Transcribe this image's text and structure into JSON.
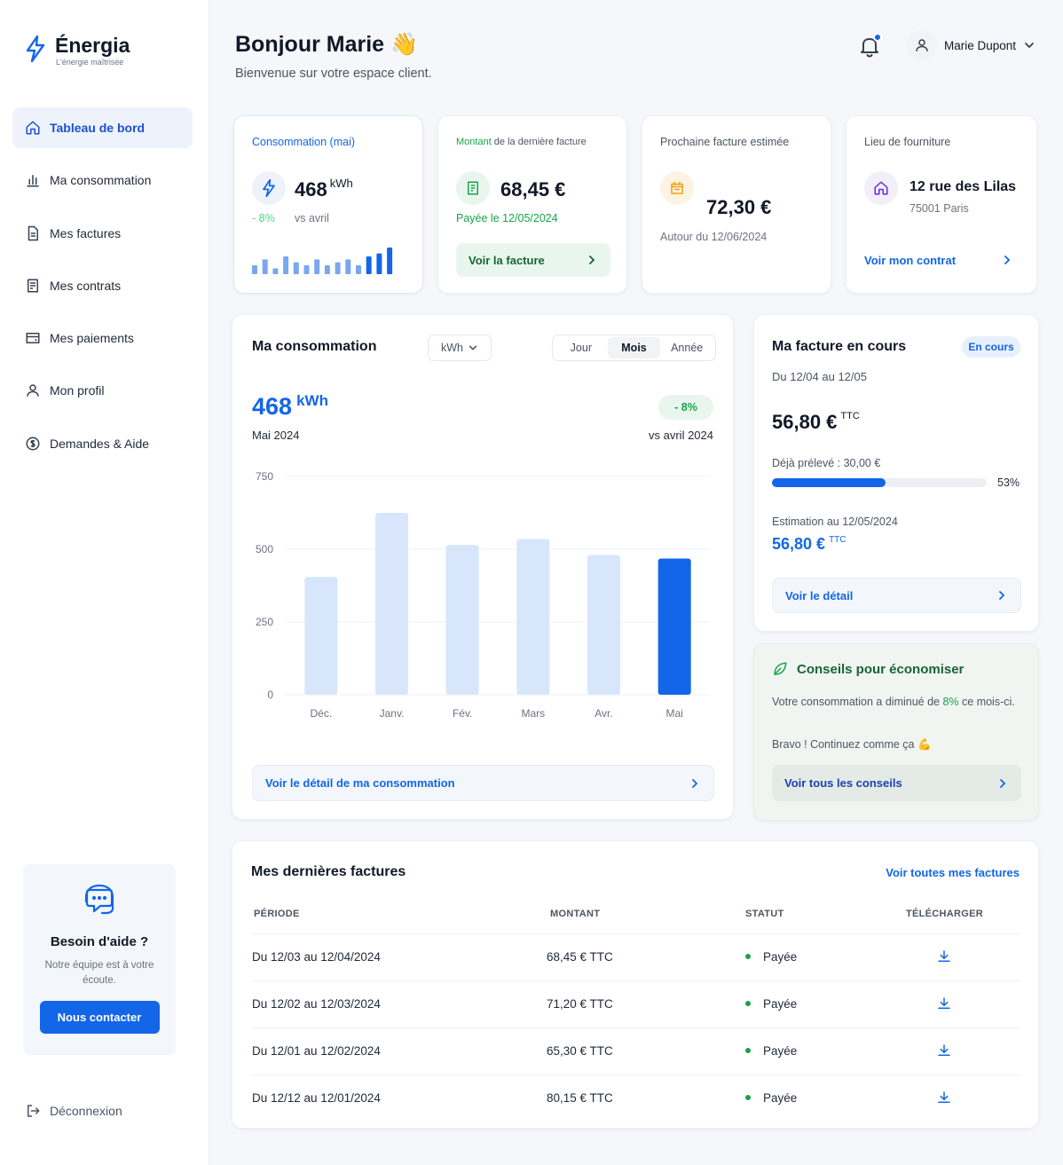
{
  "brand": {
    "name": "Énergia",
    "tagline": "L'énergie maîtrisée"
  },
  "nav": [
    {
      "label": "Tableau de bord",
      "icon": "home-icon",
      "active": true
    },
    {
      "label": "Ma consommation",
      "icon": "bar-chart-icon"
    },
    {
      "label": "Mes factures",
      "icon": "file-text-icon"
    },
    {
      "label": "Mes contrats",
      "icon": "contract-icon"
    },
    {
      "label": "Mes paiements",
      "icon": "wallet-icon"
    },
    {
      "label": "Mon profil",
      "icon": "user-icon"
    },
    {
      "label": "Demandes & Aide",
      "icon": "help-icon"
    }
  ],
  "help": {
    "title": "Besoin d'aide ?",
    "text": "Notre équipe est à votre écoute.",
    "button": "Nous contacter"
  },
  "logout": "Déconnexion",
  "header": {
    "greeting": "Bonjour Marie 👋",
    "welcome": "Bienvenue sur votre espace client.",
    "user": "Marie Dupont"
  },
  "kpi": {
    "consumption": {
      "label": "Consommation (mai)",
      "value": "468",
      "unit": "kWh",
      "delta": "- 8%",
      "compare": "vs avril",
      "sparkline": [
        3,
        5,
        2,
        6,
        4,
        3,
        5,
        3,
        4,
        5,
        3,
        6,
        7,
        9
      ]
    },
    "last_bill": {
      "label_prefix": "Montant",
      "label_rest": " de la dernière facture",
      "value": "68,45 €",
      "status": "Payée le 12/05/2024",
      "button": "Voir la facture"
    },
    "next_bill": {
      "label": "Prochaine facture estimée",
      "value": "72,30 €",
      "date": "Autour du 12/06/2024"
    },
    "supply": {
      "label": "Lieu de fourniture",
      "street": "12 rue des Lilas",
      "city": "75001 Paris",
      "link": "Voir mon contrat"
    }
  },
  "consumption_card": {
    "title": "Ma consommation",
    "unit_select": "kWh",
    "periods": [
      "Jour",
      "Mois",
      "Année"
    ],
    "active_period": "Mois",
    "value": "468",
    "unit": "kWh",
    "period_label": "Mai 2024",
    "delta": "- 8%",
    "compare": "vs avril 2024",
    "link": "Voir le détail de ma consommation"
  },
  "chart_data": {
    "type": "bar",
    "categories": [
      "Déc.",
      "Janv.",
      "Fév.",
      "Mars",
      "Avr.",
      "Mai"
    ],
    "values": [
      405,
      625,
      515,
      535,
      480,
      468
    ],
    "highlight_index": 5,
    "yticks": [
      "750",
      "500",
      "250",
      "0"
    ],
    "ylim": [
      0,
      750
    ],
    "grid": true,
    "colors": {
      "bar": "#d8e6fb",
      "highlight": "#1366e8"
    }
  },
  "bill_card": {
    "title": "Ma facture en cours",
    "badge": "En cours",
    "period": "Du 12/04 au 12/05",
    "amount": "56,80 €",
    "tax": "TTC",
    "paid_label": "Déjà prélevé : 30,00 €",
    "progress": 0.53,
    "progress_label": "53%",
    "estimate_label": "Estimation au 12/05/2024",
    "estimate_amount": "56,80 €",
    "estimate_tax": "TTC",
    "button": "Voir le détail"
  },
  "tips_card": {
    "title": "Conseils pour économiser",
    "text_before": "Votre consommation a diminué de ",
    "text_highlight": "8%",
    "text_after": " ce mois-ci.",
    "bravo": "Bravo ! Continuez comme ça 💪",
    "button": "Voir tous les conseils"
  },
  "invoices": {
    "title": "Mes dernières factures",
    "link": "Voir toutes mes factures",
    "columns": [
      "PÉRIODE",
      "MONTANT",
      "STATUT",
      "TÉLÉCHARGER"
    ],
    "rows": [
      {
        "period": "Du 12/03 au 12/04/2024",
        "amount": "68,45 € TTC",
        "status": "Payée"
      },
      {
        "period": "Du 12/02 au 12/03/2024",
        "amount": "71,20 € TTC",
        "status": "Payée"
      },
      {
        "period": "Du 12/01 au 12/02/2024",
        "amount": "65,30 € TTC",
        "status": "Payée"
      },
      {
        "period": "Du 12/12 au 12/01/2024",
        "amount": "80,15 € TTC",
        "status": "Payée"
      }
    ]
  },
  "colors": {
    "accent": "#1366e8",
    "success": "#16a34a",
    "background": "#f5f7fa"
  }
}
